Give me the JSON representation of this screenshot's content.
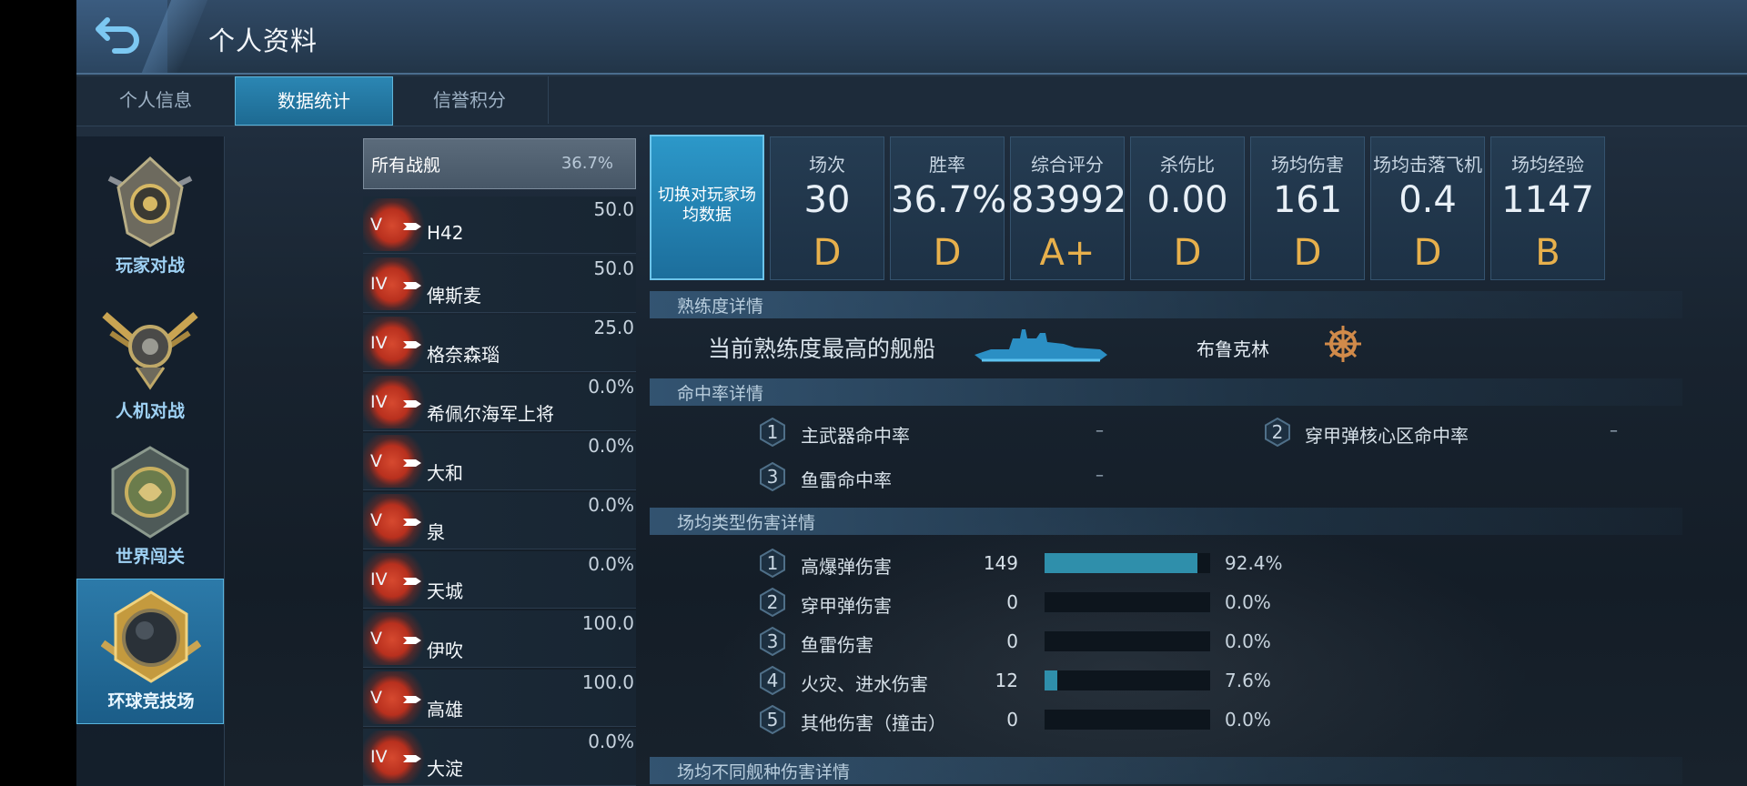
{
  "header": {
    "title": "个人资料"
  },
  "tabs": [
    {
      "label": "个人信息",
      "active": false
    },
    {
      "label": "数据统计",
      "active": true
    },
    {
      "label": "信誉积分",
      "active": false
    }
  ],
  "modes": [
    {
      "label": "玩家对战",
      "active": false
    },
    {
      "label": "人机对战",
      "active": false
    },
    {
      "label": "世界闯关",
      "active": false
    },
    {
      "label": "环球竞技场",
      "active": true
    }
  ],
  "all_ships": {
    "label": "所有战舰",
    "value": "36.7%"
  },
  "ships": [
    {
      "tier": "V",
      "name": "H42",
      "value": "50.0"
    },
    {
      "tier": "IV",
      "name": "俾斯麦",
      "value": "50.0"
    },
    {
      "tier": "IV",
      "name": "格奈森瑙",
      "value": "25.0"
    },
    {
      "tier": "IV",
      "name": "希佩尔海军上将",
      "value": "0.0%"
    },
    {
      "tier": "V",
      "name": "大和",
      "value": "0.0%"
    },
    {
      "tier": "V",
      "name": "泉",
      "value": "0.0%"
    },
    {
      "tier": "IV",
      "name": "天城",
      "value": "0.0%"
    },
    {
      "tier": "V",
      "name": "伊吹",
      "value": "100.0"
    },
    {
      "tier": "V",
      "name": "高雄",
      "value": "100.0"
    },
    {
      "tier": "IV",
      "name": "大淀",
      "value": "0.0%"
    }
  ],
  "switch_button": {
    "label": "切换对玩家场均数据"
  },
  "stats": [
    {
      "label": "场次",
      "value": "30",
      "grade": "D"
    },
    {
      "label": "胜率",
      "value": "36.7%",
      "grade": "D"
    },
    {
      "label": "综合评分",
      "value": "83992",
      "grade": "A+"
    },
    {
      "label": "杀伤比",
      "value": "0.00",
      "grade": "D"
    },
    {
      "label": "场均伤害",
      "value": "161",
      "grade": "D"
    },
    {
      "label": "场均击落飞机",
      "value": "0.4",
      "grade": "D"
    },
    {
      "label": "场均经验",
      "value": "1147",
      "grade": "B"
    }
  ],
  "mastery": {
    "section_title": "熟练度详情",
    "label": "当前熟练度最高的舰船",
    "ship_name": "布鲁克林"
  },
  "hit_rate": {
    "section_title": "命中率详情",
    "items": [
      {
        "index": "1",
        "label": "主武器命中率",
        "value": "–"
      },
      {
        "index": "2",
        "label": "穿甲弹核心区命中率",
        "value": "–"
      },
      {
        "index": "3",
        "label": "鱼雷命中率",
        "value": "–"
      }
    ]
  },
  "damage_types": {
    "section_title": "场均类型伤害详情",
    "items": [
      {
        "index": "1",
        "label": "高爆弹伤害",
        "value": "149",
        "percent": "92.4%",
        "fraction": 0.924
      },
      {
        "index": "2",
        "label": "穿甲弹伤害",
        "value": "0",
        "percent": "0.0%",
        "fraction": 0.0
      },
      {
        "index": "3",
        "label": "鱼雷伤害",
        "value": "0",
        "percent": "0.0%",
        "fraction": 0.0
      },
      {
        "index": "4",
        "label": "火灾、进水伤害",
        "value": "12",
        "percent": "7.6%",
        "fraction": 0.076
      },
      {
        "index": "5",
        "label": "其他伤害（撞击）",
        "value": "0",
        "percent": "0.0%",
        "fraction": 0.0
      }
    ]
  },
  "ship_type_damage": {
    "section_title": "场均不同舰种伤害详情"
  },
  "colors": {
    "accent": "#2c98c9",
    "grade": "#e7b04c",
    "bar_fill": "#2f8fab"
  }
}
